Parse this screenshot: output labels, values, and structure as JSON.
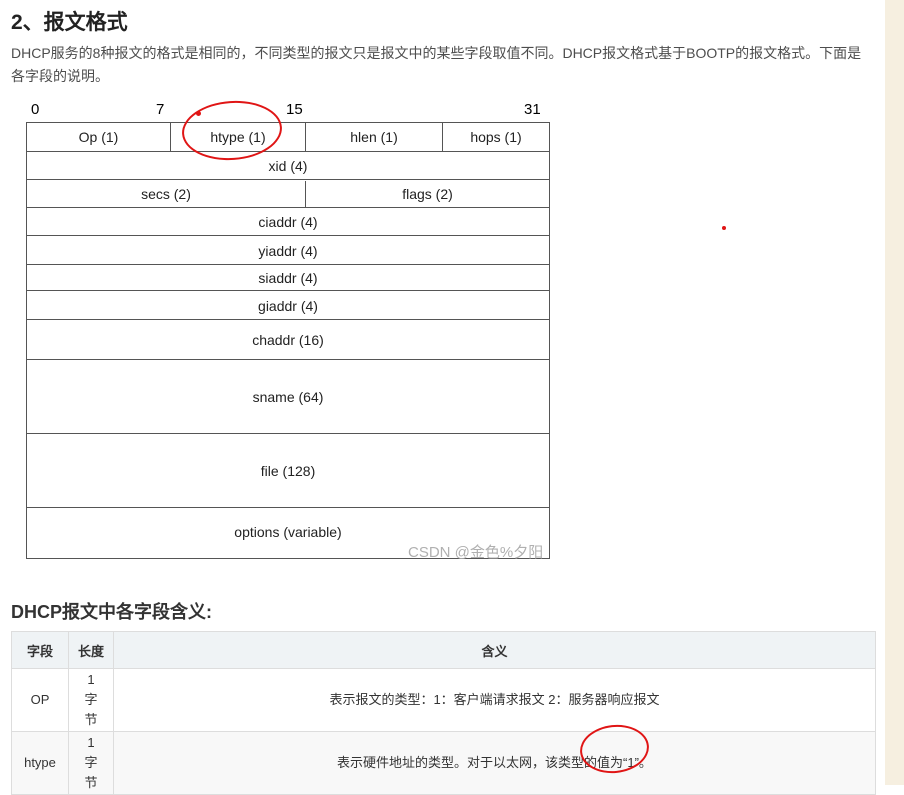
{
  "section": {
    "title": "2、报文格式",
    "intro": "DHCP服务的8种报文的格式是相同的，不同类型的报文只是报文中的某些字段取值不同。DHCP报文格式基于BOOTP的报文格式。下面是各字段的说明。"
  },
  "figure": {
    "bit_labels": [
      "0",
      "7",
      "15",
      "31"
    ],
    "rows": [
      [
        "Op (1)",
        "htype (1)",
        "hlen (1)",
        "hops (1)"
      ],
      [
        "xid (4)"
      ],
      [
        "secs (2)",
        "flags (2)"
      ],
      [
        "ciaddr (4)"
      ],
      [
        "yiaddr (4)"
      ],
      [
        "siaddr (4)"
      ],
      [
        "giaddr (4)"
      ],
      [
        "chaddr (16)"
      ],
      [
        "sname (64)"
      ],
      [
        "file (128)"
      ],
      [
        "options (variable)"
      ]
    ],
    "watermark": "CSDN @金色%夕阳"
  },
  "table_section": {
    "title": "DHCP报文中各字段含义:",
    "headers": [
      "字段",
      "长度",
      "含义"
    ],
    "rows": [
      [
        "OP",
        "1字节",
        "表示报文的类型：1：客户端请求报文 2：服务器响应报文"
      ],
      [
        "htype",
        "1字节",
        "表示硬件地址的类型。对于以太网，该类型的值为“1”。"
      ]
    ]
  },
  "colors": {
    "annotation": "#e01515",
    "table_header_bg": "#eff3f5"
  }
}
